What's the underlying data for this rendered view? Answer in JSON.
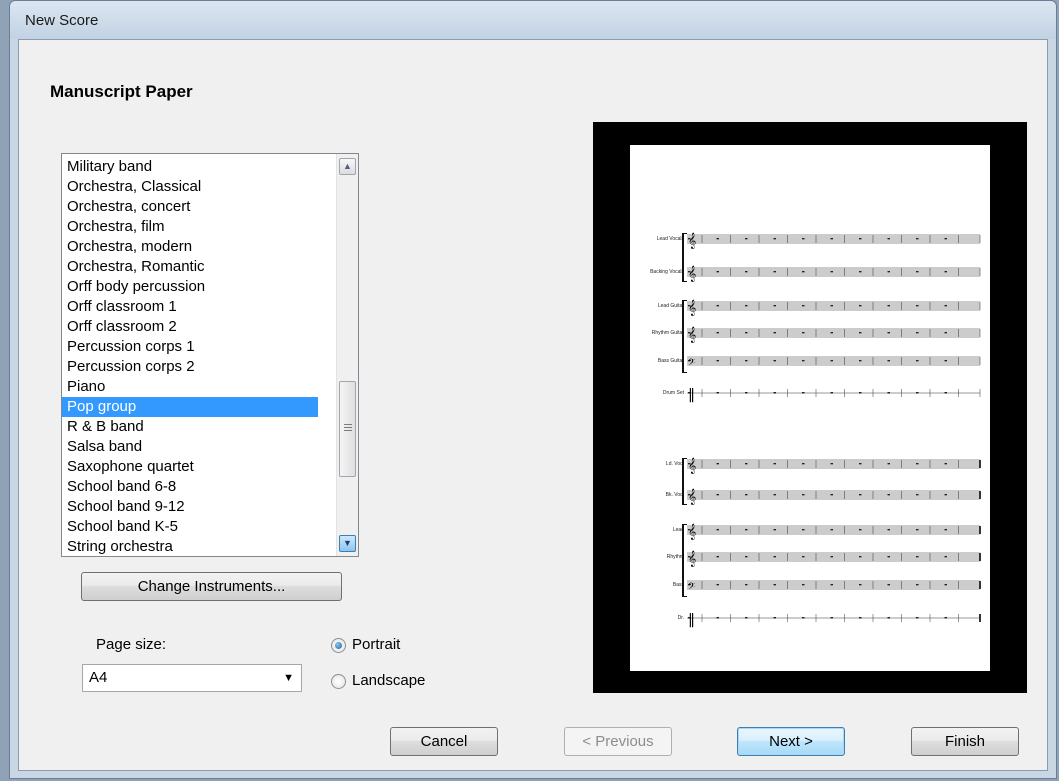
{
  "window": {
    "title": "New Score"
  },
  "page": {
    "heading": "Manuscript Paper"
  },
  "template_list": {
    "items": [
      "Military band",
      "Orchestra, Classical",
      "Orchestra, concert",
      "Orchestra, film",
      "Orchestra, modern",
      "Orchestra, Romantic",
      "Orff body percussion",
      "Orff classroom 1",
      "Orff classroom 2",
      "Percussion corps 1",
      "Percussion corps 2",
      "Piano",
      "Pop group",
      "R & B band",
      "Salsa band",
      "Saxophone quartet",
      "School band 6-8",
      "School band 9-12",
      "School band K-5",
      "String orchestra"
    ],
    "selected": "Pop group"
  },
  "buttons": {
    "change_instruments": "Change Instruments...",
    "cancel": "Cancel",
    "previous": "< Previous",
    "next": "Next >",
    "finish": "Finish"
  },
  "page_size": {
    "label": "Page size:",
    "value": "A4"
  },
  "orientation": {
    "portrait": "Portrait",
    "landscape": "Landscape",
    "selected": "Portrait"
  },
  "preview": {
    "system1": [
      "Lead Vocals",
      "Backing Vocals",
      "Lead Guitar",
      "Rhythm Guitar",
      "Bass Guitar",
      "Drum Set"
    ],
    "system2": [
      "Ld. Voc.",
      "Bk. Voc.",
      "Lead",
      "Rhythm",
      "Bass",
      "Dr."
    ]
  }
}
